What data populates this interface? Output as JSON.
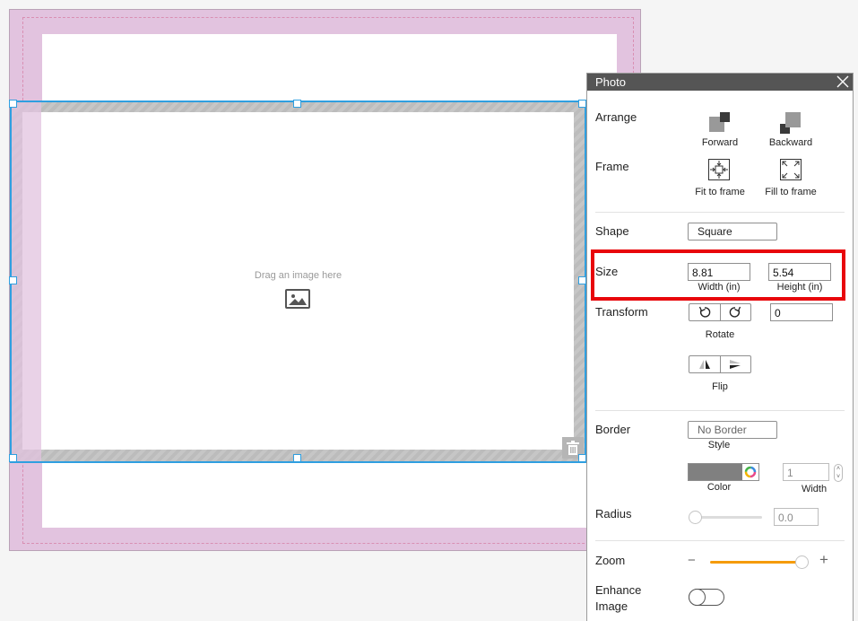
{
  "canvas": {
    "drop_hint": "Drag an image here"
  },
  "panel": {
    "title": "Photo",
    "arrange": {
      "label": "Arrange",
      "forward": "Forward",
      "backward": "Backward"
    },
    "frame": {
      "label": "Frame",
      "fit": "Fit to frame",
      "fill": "Fill to frame"
    },
    "shape": {
      "label": "Shape",
      "value": "Square"
    },
    "size": {
      "label": "Size",
      "width_value": "8.81",
      "width_caption": "Width (in)",
      "height_value": "5.54",
      "height_caption": "Height (in)"
    },
    "transform": {
      "label": "Transform",
      "rotate_caption": "Rotate",
      "angle_value": "0",
      "flip_caption": "Flip"
    },
    "border": {
      "label": "Border",
      "style_value": "No Border",
      "style_caption": "Style",
      "color_caption": "Color",
      "width_value": "1",
      "width_caption": "Width"
    },
    "radius": {
      "label": "Radius",
      "value": "0.0",
      "level": 0
    },
    "zoom": {
      "label": "Zoom",
      "minus": "−",
      "plus": "+",
      "level": 0.95
    },
    "enhance": {
      "label_line1": "Enhance",
      "label_line2": "Image",
      "enabled": false
    }
  },
  "colors": {
    "page_background": "#e2c3df",
    "selection": "#2f9fe0",
    "highlight": "#e8060b",
    "zoom_slider": "#f59b0b",
    "border_color": "#808080"
  }
}
